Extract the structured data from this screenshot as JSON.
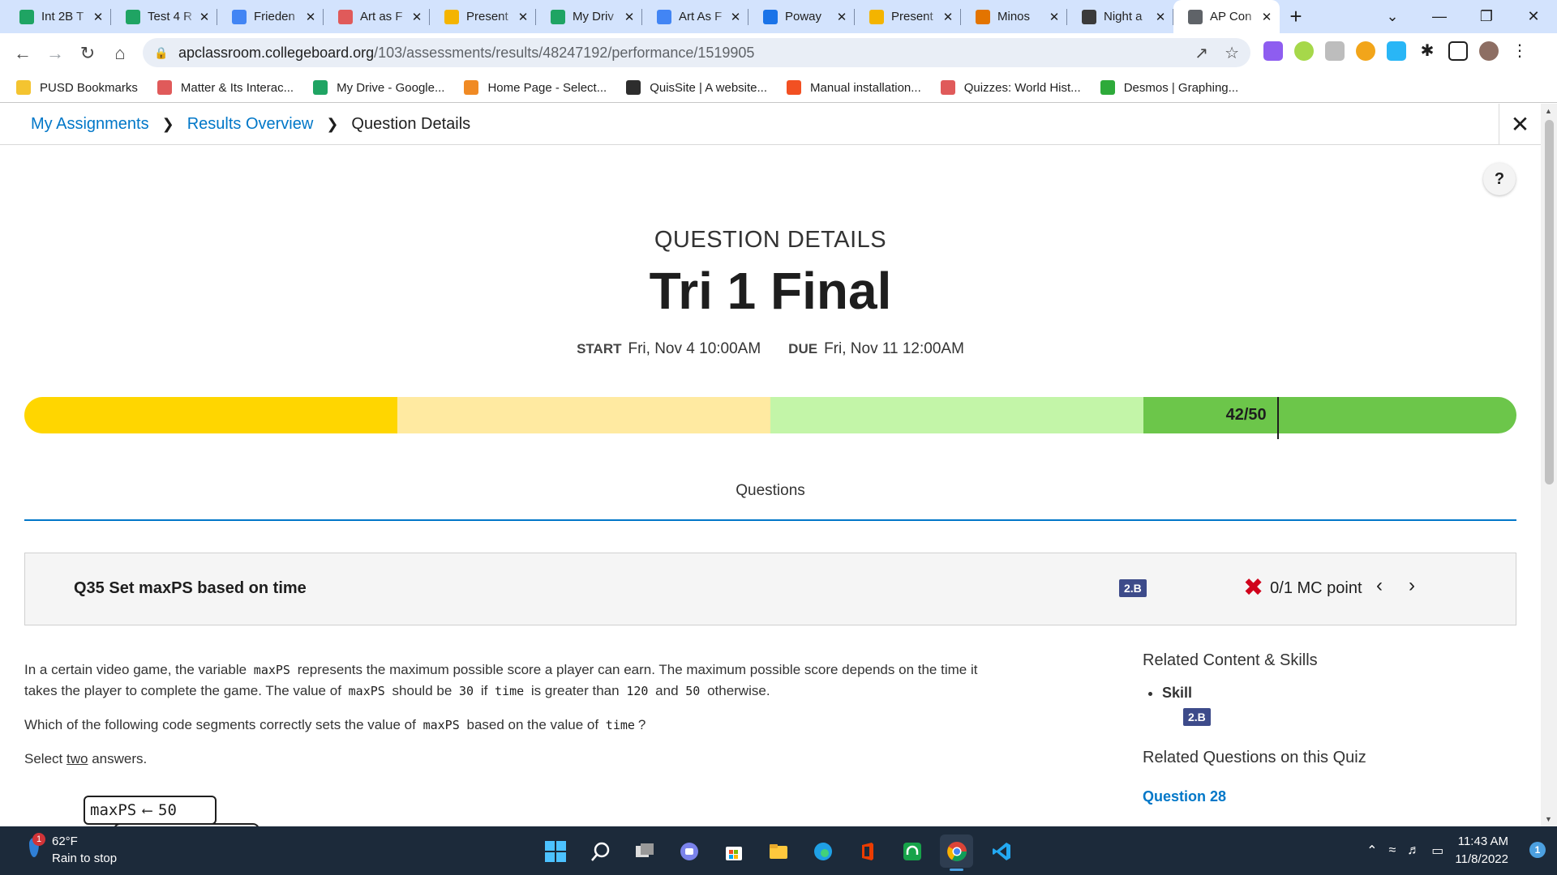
{
  "browser": {
    "tabs": [
      {
        "title": "Int 2B T",
        "icon": "google-drive-icon",
        "color": "#1fa463"
      },
      {
        "title": "Test 4 R",
        "icon": "google-drive-icon",
        "color": "#1fa463"
      },
      {
        "title": "Frieden",
        "icon": "google-docs-icon",
        "color": "#4285f4"
      },
      {
        "title": "Art as F",
        "icon": "wheel-icon",
        "color": "#e05a5a"
      },
      {
        "title": "Present",
        "icon": "google-slides-icon",
        "color": "#f4b400"
      },
      {
        "title": "My Driv",
        "icon": "google-drive-icon",
        "color": "#1fa463"
      },
      {
        "title": "Art As F",
        "icon": "google-docs-icon",
        "color": "#4285f4"
      },
      {
        "title": "Poway",
        "icon": "accessibility-icon",
        "color": "#1a73e8"
      },
      {
        "title": "Present",
        "icon": "google-slides-icon",
        "color": "#f4b400"
      },
      {
        "title": "Minos",
        "icon": "g-logo-icon",
        "color": "#e37400"
      },
      {
        "title": "Night a",
        "icon": "book-cover-icon",
        "color": "#3a3a3a"
      },
      {
        "title": "AP Con",
        "icon": "globe-icon",
        "color": "#5f6368",
        "active": true
      }
    ],
    "url_host": "apclassroom.collegeboard.org",
    "url_path": "/103/assessments/results/48247192/performance/1519905",
    "bookmarks": [
      {
        "label": "PUSD Bookmarks",
        "color": "#f4c430"
      },
      {
        "label": "Matter & Its Interac...",
        "color": "#e05a5a"
      },
      {
        "label": "My Drive - Google...",
        "color": "#1fa463"
      },
      {
        "label": "Home Page - Select...",
        "color": "#f08a24"
      },
      {
        "label": "QuisSite | A website...",
        "color": "#2d2d2d"
      },
      {
        "label": "Manual installation...",
        "color": "#f25022"
      },
      {
        "label": "Quizzes: World Hist...",
        "color": "#e05a5a"
      },
      {
        "label": "Desmos | Graphing...",
        "color": "#2eaa3a"
      }
    ]
  },
  "breadcrumb": {
    "items": [
      "My Assignments",
      "Results Overview"
    ],
    "current": "Question Details"
  },
  "help_label": "?",
  "header": {
    "eyebrow": "QUESTION DETAILS",
    "title": "Tri 1 Final",
    "start_label": "START",
    "start_value": "Fri, Nov 4 10:00AM",
    "due_label": "DUE",
    "due_value": "Fri, Nov 11 12:00AM"
  },
  "score": {
    "label": "42/50",
    "earned": 42,
    "total": 50,
    "segment_colors": [
      "#ffd600",
      "#ffeaa1",
      "#c3f5a8",
      "#6cc64a"
    ]
  },
  "questions_tab": "Questions",
  "question": {
    "title": "Q35 Set maxPS based on time",
    "skill_badge": "2.B",
    "result": "0/1 MC point",
    "points_earned": 0,
    "points_total": 1,
    "stem_p1_a": "In a certain video game, the variable",
    "stem_p1_var": "maxPS",
    "stem_p1_b": "represents the maximum possible score a player can earn. The maximum possible score depends on the time it takes the player to complete the game. The value of",
    "stem_p1_var2": "maxPS",
    "stem_p1_c": "should be",
    "stem_p1_v30": "30",
    "stem_p1_d": "if",
    "stem_p1_time": "time",
    "stem_p1_e": "is greater than",
    "stem_p1_v120": "120",
    "stem_p1_f": "and",
    "stem_p1_v50": "50",
    "stem_p1_g": "otherwise.",
    "stem_p2_a": "Which of the following code segments correctly sets the value of",
    "stem_p2_var": "maxPS",
    "stem_p2_b": "based on the value of",
    "stem_p2_time": "time",
    "stem_p2_c": "?",
    "stem_p3_a": "Select",
    "stem_p3_u": "two",
    "stem_p3_b": "answers.",
    "code_var": "maxPS",
    "code_arrow": "⟵",
    "code_val": "50"
  },
  "sidebar": {
    "related_heading": "Related Content & Skills",
    "skill_item": "Skill",
    "skill_badge": "2.B",
    "related_questions_heading": "Related Questions on this Quiz",
    "related_link": "Question 28"
  },
  "taskbar": {
    "weather_temp": "62°F",
    "weather_desc": "Rain to stop",
    "weather_badge": "1",
    "time": "11:43 AM",
    "date": "11/8/2022",
    "notifications": "1"
  }
}
